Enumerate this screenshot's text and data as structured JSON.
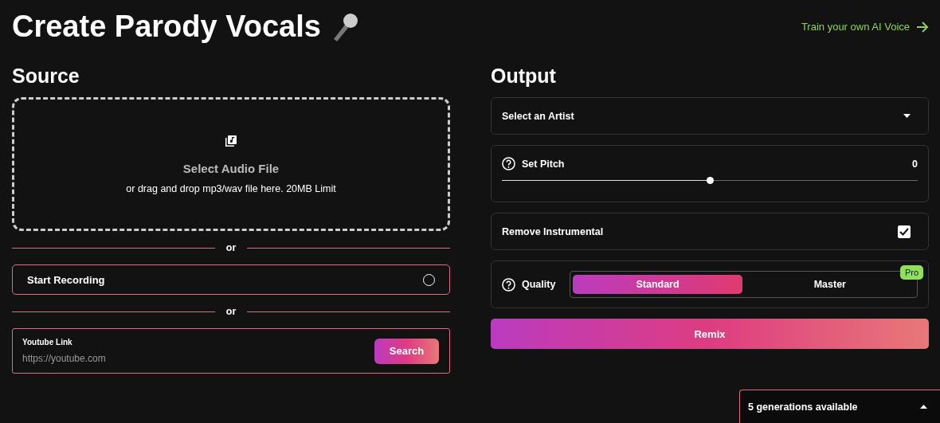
{
  "header": {
    "title": "Create Parody Vocals",
    "link": "Train your own AI Voice"
  },
  "source": {
    "heading": "Source",
    "dropzone": {
      "title": "Select Audio File",
      "hint": "or drag and drop mp3/wav file here. 20MB Limit"
    },
    "dividers": [
      "or",
      "or"
    ],
    "recording": {
      "label": "Start Recording",
      "on": false
    },
    "youtube": {
      "label": "Youtube Link",
      "placeholder": "https://youtube.com",
      "button": "Search"
    }
  },
  "output": {
    "heading": "Output",
    "artist": {
      "placeholder": "Select an Artist"
    },
    "pitch": {
      "label": "Set Pitch",
      "reading": "0",
      "level": 0.5
    },
    "remove_instrumental": {
      "label": "Remove Instrumental",
      "checked": true
    },
    "quality": {
      "label": "Quality",
      "options": [
        {
          "label": "Standard",
          "selected": true
        },
        {
          "label": "Master",
          "selected": false,
          "badge": "Pro"
        }
      ]
    },
    "button": "Remix"
  },
  "generations": {
    "label": "5 generations available"
  }
}
